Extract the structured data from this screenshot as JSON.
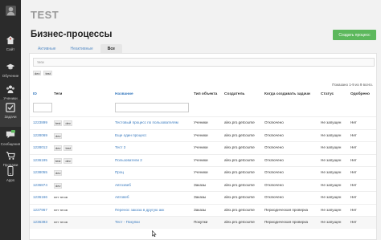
{
  "sidebar": {
    "items": [
      {
        "label": "",
        "icon": "avatar-icon"
      },
      {
        "label": "Сайт",
        "icon": "home-icon"
      },
      {
        "label": "Обучение",
        "icon": "graduation-icon"
      },
      {
        "label": "Ученики",
        "icon": "users-icon"
      },
      {
        "label": "Задачи",
        "icon": "checkbox-icon"
      },
      {
        "label": "Сообщения",
        "icon": "chat-icon"
      },
      {
        "label": "Продажи",
        "icon": "cart-icon"
      },
      {
        "label": "Apps",
        "icon": "phone-icon"
      }
    ]
  },
  "brand": "TEST",
  "page_title": "Бизнес-процессы",
  "create_button": "Создать процесс",
  "tabs": [
    {
      "label": "Активные"
    },
    {
      "label": "Неактивные"
    },
    {
      "label": "Все"
    }
  ],
  "filter": {
    "placeholder": "теги",
    "chips": [
      "dev",
      "test"
    ]
  },
  "count_text": "Показано 1-9 из 9 всего.",
  "columns": {
    "id": "ID",
    "tags": "Теги",
    "name": "Название",
    "type": "Тип объекта",
    "creator": "Создатель",
    "when": "Когда создавать задачи",
    "status": "Статус",
    "approved": "Одобрено"
  },
  "rows": [
    {
      "id": "1223899",
      "tags": [
        "test",
        "dev"
      ],
      "tag_style": "chip",
      "name": "Тестовый процесс по пользователям",
      "type": "Ученики",
      "creator": "alex.pro.getcourse",
      "when": "Отключено",
      "status": "Не запущен",
      "approved": "Нет"
    },
    {
      "id": "1228069",
      "tags": [
        "dev"
      ],
      "tag_style": "chip",
      "name": "Еще один процесс",
      "type": "Ученики",
      "creator": "alex.pro.getcourse",
      "when": "Отключено",
      "status": "Не запущен",
      "approved": "Нет"
    },
    {
      "id": "1228012",
      "tags": [
        "dev",
        "test"
      ],
      "tag_style": "chip",
      "name": "Тест 2",
      "type": "Ученики",
      "creator": "alex.pro.getcourse",
      "when": "Отключено",
      "status": "Не запущен",
      "approved": "Нет"
    },
    {
      "id": "1236195",
      "tags": [
        "test",
        "dev"
      ],
      "tag_style": "chip",
      "name": "Пользователи 2",
      "type": "Ученики",
      "creator": "alex.pro.getcourse",
      "when": "Отключено",
      "status": "Не запущен",
      "approved": "Нет"
    },
    {
      "id": "1238055",
      "tags": [
        "dev"
      ],
      "tag_style": "chip",
      "name": "Проц",
      "type": "Ученики",
      "creator": "alex.pro.getcourse",
      "when": "Отключено",
      "status": "Не запущен",
      "approved": "Нет"
    },
    {
      "id": "1236874",
      "tags": [
        "dev"
      ],
      "tag_style": "chip",
      "name": "Автоэвеб",
      "type": "Заказы",
      "creator": "alex.pro.getcourse",
      "when": "Отключено",
      "status": "Не запущен",
      "approved": "Нет"
    },
    {
      "id": "1236166",
      "tags": [
        "нет тегов"
      ],
      "tag_style": "plain",
      "name": "Автовеб",
      "type": "Заказы",
      "creator": "alex.pro.getcourse",
      "when": "Отключено",
      "status": "Не запущен",
      "approved": "Нет"
    },
    {
      "id": "1227967",
      "tags": [
        "нет тегов"
      ],
      "tag_style": "plain",
      "name": "Перенос заказа в другую акк",
      "type": "Заказы",
      "creator": "alex.pro.getcourse",
      "when": "Периодическая проверка",
      "status": "Не запущен",
      "approved": "Нет"
    },
    {
      "id": "1236393",
      "tags": [
        "нет тегов"
      ],
      "tag_style": "plain",
      "name": "Тест - Покупки",
      "type": "Покупки",
      "creator": "alex.pro.getcourse",
      "when": "Периодическая проверка",
      "status": "Не запущен",
      "approved": "Нет"
    }
  ]
}
